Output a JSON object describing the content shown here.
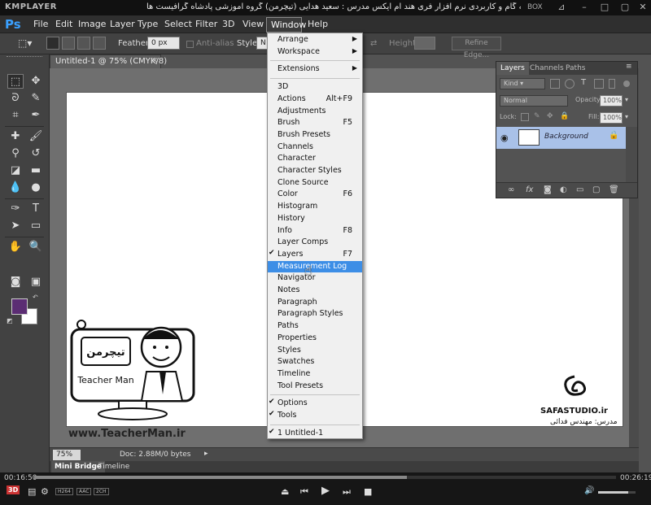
{
  "kmplayer": {
    "app_name": "KMPLAYER",
    "caption": "مجموعه آموزشی جامع ، گام به گام و کاربردی نرم افزار فری هند ام ایکس  مدرس : سعید هدایی (تیچرمن) گروه آموزشی پادشاه گرافیست ها",
    "box_label": "BOX",
    "time_elapsed": "00:16:50",
    "time_total": "00:26:19",
    "progress": 0.64,
    "volume": 0.8,
    "badges": [
      "H264",
      "AAC",
      "2CH"
    ],
    "controls": [
      "3D",
      "menu",
      "eject",
      "prev",
      "play",
      "next",
      "stop"
    ]
  },
  "photoshop": {
    "logo": "Ps",
    "menus": [
      "File",
      "Edit",
      "Image",
      "Layer",
      "Type",
      "Select",
      "Filter",
      "3D",
      "View",
      "Window",
      "Help"
    ],
    "options": {
      "feather_label": "Feather:",
      "feather_value": "0 px",
      "antialias_label": "Anti-alias",
      "style_label": "Style:",
      "style_value": "N",
      "height_label": "Height:",
      "refine_edge": "Refine Edge..."
    },
    "document_tab": {
      "title": "Untitled-1 @ 75% (CMYK/8)",
      "close": "×"
    },
    "status": {
      "zoom": "75%",
      "doc_size": "Doc: 2.88M/0 bytes"
    },
    "bottom_tabs": [
      "Mini Bridge",
      "Timeline"
    ],
    "colors": {
      "foreground": "#5b2d73",
      "background": "#ffffff",
      "menu_highlight": "#3d8ee6"
    }
  },
  "layers_panel": {
    "tabs": [
      "Layers",
      "Channels",
      "Paths"
    ],
    "kind_label": "Kind",
    "blend_mode": "Normal",
    "opacity_label": "Opacity:",
    "opacity_value": "100%",
    "lock_label": "Lock:",
    "fill_label": "Fill:",
    "fill_value": "100%",
    "layer_name": "Background"
  },
  "window_menu": {
    "items": [
      {
        "label": "Arrange",
        "submenu": true
      },
      {
        "label": "Workspace",
        "submenu": true
      },
      {
        "sep": true
      },
      {
        "label": "Extensions",
        "submenu": true
      },
      {
        "sep": true
      },
      {
        "label": "3D"
      },
      {
        "label": "Actions",
        "shortcut": "Alt+F9"
      },
      {
        "label": "Adjustments"
      },
      {
        "label": "Brush",
        "shortcut": "F5"
      },
      {
        "label": "Brush Presets"
      },
      {
        "label": "Channels"
      },
      {
        "label": "Character"
      },
      {
        "label": "Character Styles"
      },
      {
        "label": "Clone Source"
      },
      {
        "label": "Color",
        "shortcut": "F6"
      },
      {
        "label": "Histogram"
      },
      {
        "label": "History"
      },
      {
        "label": "Info",
        "shortcut": "F8"
      },
      {
        "label": "Layer Comps"
      },
      {
        "label": "Layers",
        "shortcut": "F7",
        "checked": true
      },
      {
        "label": "Measurement Log",
        "highlighted": true
      },
      {
        "label": "Navigator"
      },
      {
        "label": "Notes"
      },
      {
        "label": "Paragraph"
      },
      {
        "label": "Paragraph Styles"
      },
      {
        "label": "Paths"
      },
      {
        "label": "Properties"
      },
      {
        "label": "Styles"
      },
      {
        "label": "Swatches"
      },
      {
        "label": "Timeline"
      },
      {
        "label": "Tool Presets"
      },
      {
        "sep": true
      },
      {
        "label": "Options",
        "checked": true
      },
      {
        "label": "Tools",
        "checked": true
      },
      {
        "sep": true
      },
      {
        "label": "1 Untitled-1",
        "checked": true
      }
    ]
  },
  "watermarks": {
    "teacherman_brand": "Teacher Man",
    "teacherman_url": "www.TeacherMan.ir",
    "studio": "SAFASTUDIO.ir",
    "studio_sub": "مدرس: مهندس فدائی"
  }
}
